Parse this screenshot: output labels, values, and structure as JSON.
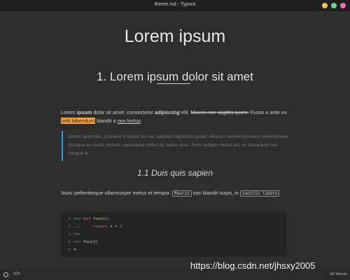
{
  "window": {
    "title": "theme.md - Typora"
  },
  "document": {
    "h1": "Lorem ipsum",
    "h2": "1. Lorem ipsum dolor sit amet",
    "p1": {
      "t1": "Lorem ",
      "t2": "ipsum",
      "t3": " dolor sit ",
      "t4": "amet",
      "t5": ", consectetur ",
      "t6": "adipiscing",
      "t7": " elit. ",
      "t8": "Mauris non sagittis quam.",
      "t9": " Fusce a ante eu ",
      "t10": "velit bibendum",
      "t11": " blandit a ",
      "t12": "non lectus",
      "t13": "."
    },
    "blockquote": "Donec ante odio, posuere tristique dui vel, aliquam dignissim quam. Aliquam laoreet posuere pellentesque. Quisque eu purus dictum, consequat metus id, varius eros. Proin tempor metus est, at consequat nisl congue at.",
    "h3": "1.1 Duis quis sapien",
    "p2": {
      "t1": "Nunc pellentesque ullamcorper metus et tempor. ",
      "code1": "Mauris",
      "t2": " non blandit turpis, in ",
      "code2": "iaculis libero",
      "t3": "."
    },
    "code_lines": [
      {
        "n": "1",
        "prompt": ">>>",
        "kw": "def",
        "fn": "foo",
        "rest": "(x):"
      },
      {
        "n": "2",
        "prompt": "...",
        "kw": "return",
        "rest": " x + ",
        "num": "1"
      },
      {
        "n": "3",
        "prompt": ">>>"
      },
      {
        "n": "4",
        "prompt": ">>>",
        "rest": " foo(3)"
      },
      {
        "n": "5",
        "rest": "4"
      }
    ]
  },
  "statusbar": {
    "outline_icon": "circle-icon",
    "source_icon": "</>",
    "word_count": "94 Words"
  },
  "watermark": "https://blog.csdn.net/jhsxy2005"
}
